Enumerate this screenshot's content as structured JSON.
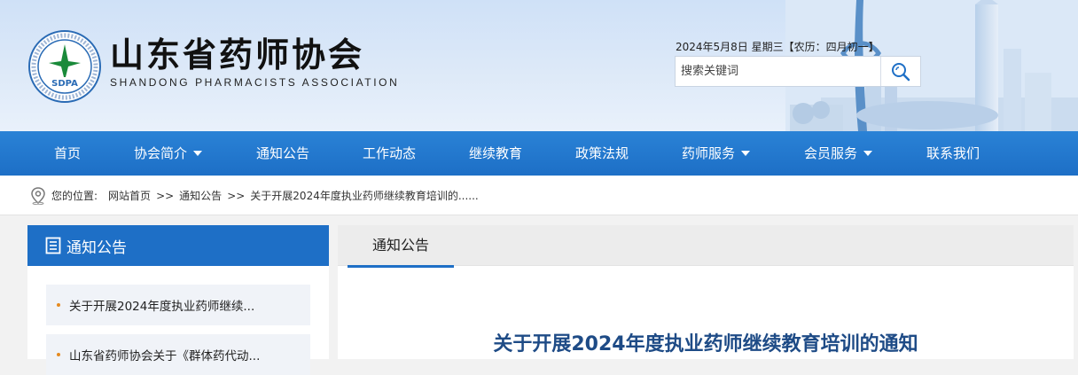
{
  "header": {
    "title": "山东省药师协会",
    "subtitle": "SHANDONG  PHARMACISTS  ASSOCIATION",
    "logo_text": "SDPA",
    "date_text": "2024年5月8日 星期三【农历：四月初一】",
    "search_placeholder": "搜索关键词"
  },
  "nav": {
    "items": [
      {
        "label": "首页",
        "dropdown": false
      },
      {
        "label": "协会简介",
        "dropdown": true
      },
      {
        "label": "通知公告",
        "dropdown": false
      },
      {
        "label": "工作动态",
        "dropdown": false
      },
      {
        "label": "继续教育",
        "dropdown": false
      },
      {
        "label": "政策法规",
        "dropdown": false
      },
      {
        "label": "药师服务",
        "dropdown": true
      },
      {
        "label": "会员服务",
        "dropdown": true
      },
      {
        "label": "联系我们",
        "dropdown": false
      }
    ]
  },
  "breadcrumb": {
    "prefix": "您的位置:",
    "home": "网站首页",
    "sep": ">>",
    "section": "通知公告",
    "current": "关于开展2024年度执业药师继续教育培训的......"
  },
  "sidebar": {
    "heading": "通知公告",
    "items": [
      {
        "label": "关于开展2024年度执业药师继续..."
      },
      {
        "label": "山东省药师协会关于《群体药代动..."
      }
    ]
  },
  "main": {
    "tab": "通知公告",
    "article_title": "关于开展2024年度执业药师继续教育培训的通知"
  },
  "colors": {
    "nav_blue": "#1d6fc6",
    "title_blue": "#1e4b86",
    "bullet_orange": "#e58a1f",
    "logo_green": "#1a8a3a"
  }
}
